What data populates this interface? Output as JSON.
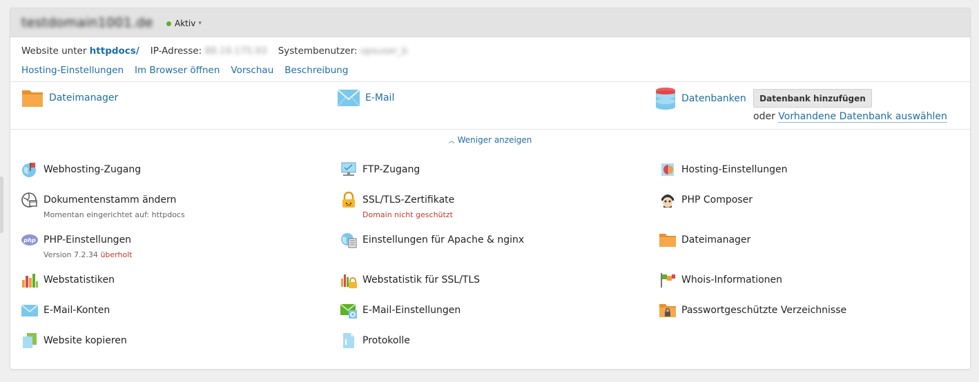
{
  "header": {
    "domain": "testdomain1001.de",
    "status_label": "Aktiv"
  },
  "info": {
    "website_prefix": "Website unter",
    "docroot_link": "httpdocs/",
    "ip_label": "IP-Adresse:",
    "ip_value": "88.19.175.93",
    "sysuser_label": "Systembenutzer:",
    "sysuser_value": "opsuser_b"
  },
  "quick_links": [
    "Hosting-Einstellungen",
    "Im Browser öffnen",
    "Vorschau",
    "Beschreibung"
  ],
  "top_tools": {
    "filemanager": "Dateimanager",
    "email": "E-Mail",
    "databases": "Datenbanken",
    "add_db_button": "Datenbank hinzufügen",
    "oder": "oder",
    "select_db_link": "Vorhandene Datenbank auswählen"
  },
  "toggle_label": "Weniger anzeigen",
  "grid": {
    "col1": [
      {
        "name": "Webhosting-Zugang",
        "icon": "webhosting-icon"
      },
      {
        "name": "Dokumentenstamm ändern",
        "sub": "Momentan eingerichtet auf: httpdocs",
        "icon": "docroot-icon"
      },
      {
        "name": "PHP-Einstellungen",
        "sub_prefix": "Version 7.2.34",
        "sub_bad": "überholt",
        "icon": "php-icon"
      },
      {
        "name": "Webstatistiken",
        "icon": "webstats-icon"
      },
      {
        "name": "E-Mail-Konten",
        "icon": "mail-accounts-icon"
      },
      {
        "name": "Website kopieren",
        "icon": "copy-site-icon"
      }
    ],
    "col2": [
      {
        "name": "FTP-Zugang",
        "icon": "ftp-icon"
      },
      {
        "name": "SSL/TLS-Zertifikate",
        "sub": "Domain nicht geschützt",
        "icon": "ssl-lock-icon"
      },
      {
        "name": "Einstellungen für Apache & nginx",
        "icon": "apache-nginx-icon"
      },
      {
        "name": "Webstatistik für SSL/TLS",
        "icon": "ssl-stats-icon"
      },
      {
        "name": "E-Mail-Einstellungen",
        "icon": "mail-settings-icon"
      },
      {
        "name": "Protokolle",
        "icon": "logs-icon"
      }
    ],
    "col3": [
      {
        "name": "Hosting-Einstellungen",
        "icon": "hosting-settings-icon"
      },
      {
        "name": "PHP Composer",
        "icon": "composer-icon"
      },
      {
        "name": "Dateimanager",
        "icon": "folder-icon"
      },
      {
        "name": "Whois-Informationen",
        "icon": "whois-icon"
      },
      {
        "name": "Passwortgeschützte Verzeichnisse",
        "icon": "protected-folder-icon"
      }
    ]
  },
  "colors": {
    "link": "#1f6ea6",
    "status_ok": "#5fb227",
    "warning": "#c0392b"
  }
}
